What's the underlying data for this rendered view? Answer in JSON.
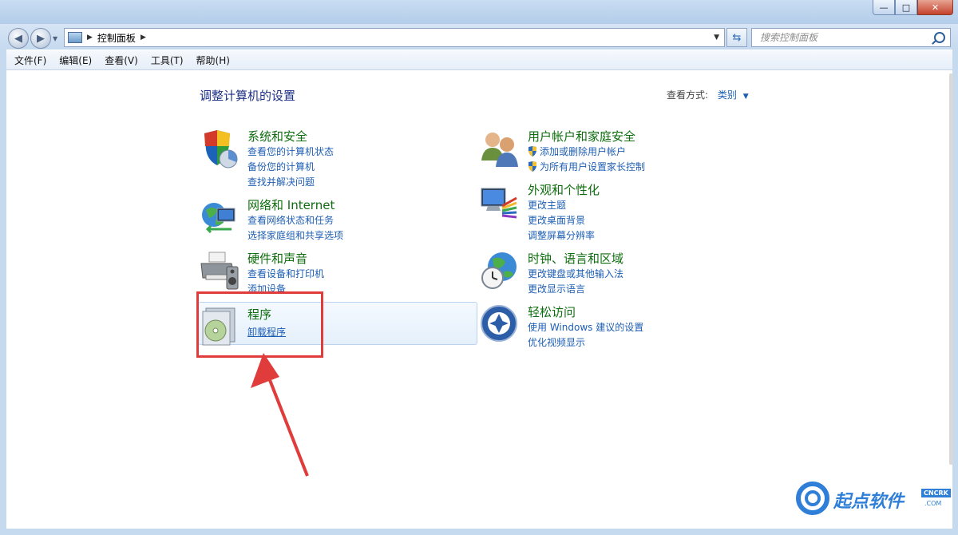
{
  "window": {
    "minimize": "—",
    "maximize": "□",
    "close": "✕"
  },
  "address": {
    "crumb": "控制面板",
    "search_placeholder": "搜索控制面板"
  },
  "menu": [
    "文件(F)",
    "编辑(E)",
    "查看(V)",
    "工具(T)",
    "帮助(H)"
  ],
  "page": {
    "title": "调整计算机的设置",
    "view_by_label": "查看方式:",
    "view_by_value": "类别"
  },
  "categories": [
    {
      "title": "系统和安全",
      "links": [
        "查看您的计算机状态",
        "备份您的计算机",
        "查找并解决问题"
      ],
      "icon": "shield-pie-icon"
    },
    {
      "title": "网络和 Internet",
      "links": [
        "查看网络状态和任务",
        "选择家庭组和共享选项"
      ],
      "icon": "network-globe-icon"
    },
    {
      "title": "硬件和声音",
      "links": [
        "查看设备和打印机",
        "添加设备"
      ],
      "icon": "printer-speaker-icon"
    },
    {
      "title": "程序",
      "links": [
        "卸载程序"
      ],
      "icon": "programs-cd-icon"
    },
    {
      "title": "用户帐户和家庭安全",
      "links": [
        "添加或删除用户帐户",
        "为所有用户设置家长控制"
      ],
      "icon": "users-icon"
    },
    {
      "title": "外观和个性化",
      "links": [
        "更改主题",
        "更改桌面背景",
        "调整屏幕分辨率"
      ],
      "icon": "monitor-palette-icon"
    },
    {
      "title": "时钟、语言和区域",
      "links": [
        "更改键盘或其他输入法",
        "更改显示语言"
      ],
      "icon": "globe-clock-icon"
    },
    {
      "title": "轻松访问",
      "links": [
        "使用 Windows 建议的设置",
        "优化视频显示"
      ],
      "icon": "ease-of-access-icon"
    }
  ],
  "watermark": {
    "text": "起点软件",
    "sub": ".COM",
    "tag": "CNCRK"
  },
  "colors": {
    "heading": "#0e6e0e",
    "link": "#1e5fb4",
    "title": "#1e3287",
    "highlight_box": "#e03c3c"
  }
}
